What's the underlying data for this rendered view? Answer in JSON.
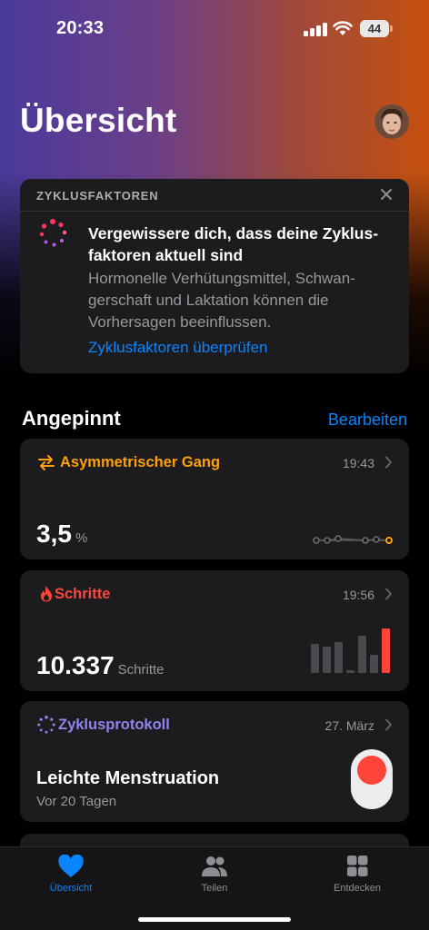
{
  "status_bar": {
    "time": "20:33",
    "battery": "44"
  },
  "header": {
    "title": "Übersicht"
  },
  "cycle_factors": {
    "header_label": "ZYKLUSFAKTOREN",
    "title": "Vergewissere dich, dass deine Zyklus-faktoren aktuell sind",
    "text": "Hormonelle Verhütungsmittel, Schwan-gerschaft und Laktation können die Vorhersagen beeinflussen.",
    "link": "Zyklusfaktoren überprüfen"
  },
  "pinned": {
    "title": "Angepinnt",
    "edit_label": "Bearbeiten"
  },
  "metrics": {
    "gait": {
      "label": "Asymmetrischer Gang",
      "time": "19:43",
      "value": "3,5",
      "unit": "%",
      "color": "#ff9f0a"
    },
    "steps": {
      "label": "Schritte",
      "time": "19:56",
      "value": "10.337",
      "unit": "Schritte",
      "color": "#ff453a",
      "bars": [
        0.62,
        0.55,
        0.66,
        0.05,
        0.78,
        0.38,
        0.95
      ]
    },
    "cycle": {
      "label": "Zyklusprotokoll",
      "date": "27. März",
      "title": "Leichte Menstruation",
      "subtitle": "Vor 20 Tagen",
      "color": "#8e84f0"
    }
  },
  "tab_bar": {
    "tabs": [
      {
        "label": "Übersicht",
        "icon": "heart-icon",
        "active": true
      },
      {
        "label": "Teilen",
        "icon": "people-icon",
        "active": false
      },
      {
        "label": "Entdecken",
        "icon": "grid-icon",
        "active": false
      }
    ]
  }
}
